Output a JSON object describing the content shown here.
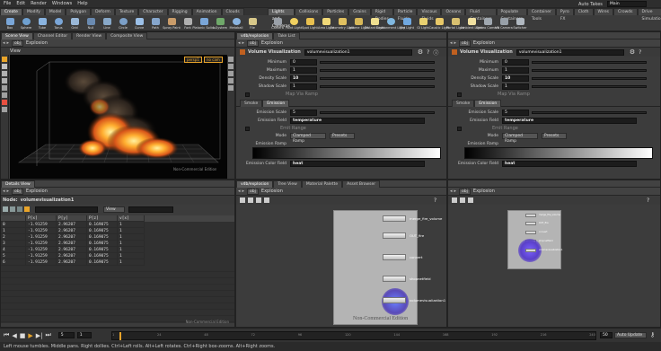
{
  "menubar": {
    "items": [
      "File",
      "Edit",
      "Render",
      "Windows",
      "Help"
    ],
    "auto_takes": "Auto Takes",
    "take": "Main"
  },
  "shelf_left": {
    "tabs": [
      "Create",
      "Modify",
      "Model",
      "Polygon",
      "Deform",
      "Texture",
      "Character",
      "Rigging",
      "Animation",
      "Clouds"
    ],
    "tools": [
      "Box",
      "Sphere",
      "Tube",
      "Torus",
      "Grid",
      "Null",
      "Line",
      "Circle",
      "Curve",
      "Path",
      "Spray Paint",
      "Font",
      "Platonic Solids",
      "L-System",
      "Metaball",
      "File"
    ]
  },
  "shelf_right": {
    "tabs": [
      "Lights and Cameras",
      "Collisions",
      "Particles",
      "Grains",
      "Rigid Bodies",
      "Particle Fluids",
      "Viscous Fluids",
      "Oceans",
      "Fluid Containers",
      "Populate Containers",
      "Container Tools",
      "Pyro FX",
      "Cloth",
      "Wires",
      "Crowds",
      "Drive Simulation"
    ],
    "tools": [
      "Camera",
      "Point Light",
      "Spot Light",
      "Area Light",
      "Geometry Light",
      "Volume Light",
      "Distant Light",
      "Environment Light",
      "Sky Light",
      "GI Light",
      "Caustic Light",
      "Portal Light",
      "Ambient Light",
      "Stereo Camera",
      "VR Camera",
      "Switcher"
    ]
  },
  "viewer": {
    "tabs": [
      "Scene View",
      "Channel Editor",
      "Render View",
      "Composite View"
    ],
    "path": "obj",
    "node": "Explosion",
    "title": "View",
    "persp": "persp1",
    "cam": "no cam",
    "watermark": "Non-Commercial Edition"
  },
  "params_left": {
    "tabs": [
      "vdb/explosion",
      "Take List"
    ],
    "path": "obj",
    "node": "Explosion",
    "type": "Volume Visualization",
    "name": "volumevisualization1",
    "rows": [
      {
        "label": "Minimum",
        "value": "0"
      },
      {
        "label": "Maximum",
        "value": "1"
      },
      {
        "label": "Density Scale",
        "value": "10"
      },
      {
        "label": "Shadow Scale",
        "value": "1"
      }
    ],
    "map_label": "Map Via Ramp",
    "sub_tabs": [
      "Smoke",
      "Emission"
    ],
    "emission_scale": {
      "label": "Emission Scale",
      "value": "5"
    },
    "emission_field": {
      "label": "Emission Field",
      "value": "temperature"
    },
    "emit_range": "Emit Range",
    "mode": {
      "label": "Mode",
      "value": "Clamped Ramp",
      "presets": "Presets"
    },
    "ramp_label": "Emission Ramp",
    "color_field": {
      "label": "Emission Color Field",
      "value": "heat"
    }
  },
  "params_right": {
    "path": "obj",
    "node": "Explosion",
    "type": "Volume Visualization",
    "name": "volumevisualization1",
    "rows": [
      {
        "label": "Minimum",
        "value": "0"
      },
      {
        "label": "Maximum",
        "value": "1"
      },
      {
        "label": "Density Scale",
        "value": "10"
      },
      {
        "label": "Shadow Scale",
        "value": "1"
      }
    ],
    "map_label": "Map Via Ramp",
    "sub_tabs": [
      "Smoke",
      "Emission"
    ],
    "emission_scale": {
      "label": "Emission Scale",
      "value": "5"
    },
    "emission_field": {
      "label": "Emission Field",
      "value": "temperature"
    },
    "emit_range": "Emit Range",
    "mode": {
      "label": "Mode",
      "value": "Clamped Ramp",
      "presets": "Presets"
    },
    "ramp_label": "Emission Ramp",
    "color_field": {
      "label": "Emission Color Field",
      "value": "heat"
    }
  },
  "spreadsheet": {
    "tab": "Details View",
    "path": "obj",
    "node": "Explosion",
    "node_label": "Node:",
    "node_name": "volumevisualization1",
    "view_label": "View",
    "columns": [
      "",
      "P[x]",
      "P[y]",
      "P[z]",
      "v[x]"
    ],
    "rows": [
      [
        "0",
        "-1.91259",
        "2.96207",
        "0.169075",
        "1"
      ],
      [
        "1",
        "-1.91259",
        "2.96207",
        "0.169075",
        "1"
      ],
      [
        "2",
        "-1.91259",
        "2.96207",
        "0.169075",
        "1"
      ],
      [
        "3",
        "-1.91259",
        "2.96207",
        "0.169075",
        "1"
      ],
      [
        "4",
        "-1.91259",
        "2.96207",
        "0.169075",
        "1"
      ],
      [
        "5",
        "-1.91259",
        "2.96207",
        "0.169075",
        "1"
      ],
      [
        "6",
        "-1.91259",
        "2.96207",
        "0.169075",
        "1"
      ]
    ],
    "watermark": "Non-Commercial Edition"
  },
  "network_left": {
    "tabs": [
      "vdb/explosion",
      "Tree View",
      "Material Palette",
      "Asset Browser"
    ],
    "path": "obj",
    "node": "Explosion",
    "nodes": [
      {
        "label": "merge_fire_volume"
      },
      {
        "label": "OUT_fire"
      },
      {
        "label": "convert"
      },
      {
        "label": "shopnetfield"
      },
      {
        "label": "volumevisualization1"
      }
    ],
    "watermark": "Non-Commercial Edition"
  },
  "network_right": {
    "path": "obj",
    "node": "Explosion",
    "nodes": [
      {
        "label": "merge_fire_volume"
      },
      {
        "label": "OUT_fire"
      },
      {
        "label": "convert"
      },
      {
        "label": "shopnetfield"
      },
      {
        "label": "volumevisualization1"
      }
    ]
  },
  "timeline": {
    "frame": "5",
    "start": "1",
    "end": "240",
    "ticks": [
      "1",
      "24",
      "48",
      "72",
      "96",
      "120",
      "144",
      "168",
      "192",
      "216",
      "240"
    ],
    "range_end": "50",
    "auto_update": "Auto Update"
  },
  "statusbar": {
    "text": "Left mouse tumbles. Middle pans. Right dollies. Ctrl+Left rolls. Alt+Left rotates. Ctrl+Right box-zooms. Alt+Right zooms."
  },
  "colors": {
    "accent": "#e8a42a",
    "node_selected": "#4a6cff",
    "fire": "#ff8a1e"
  }
}
